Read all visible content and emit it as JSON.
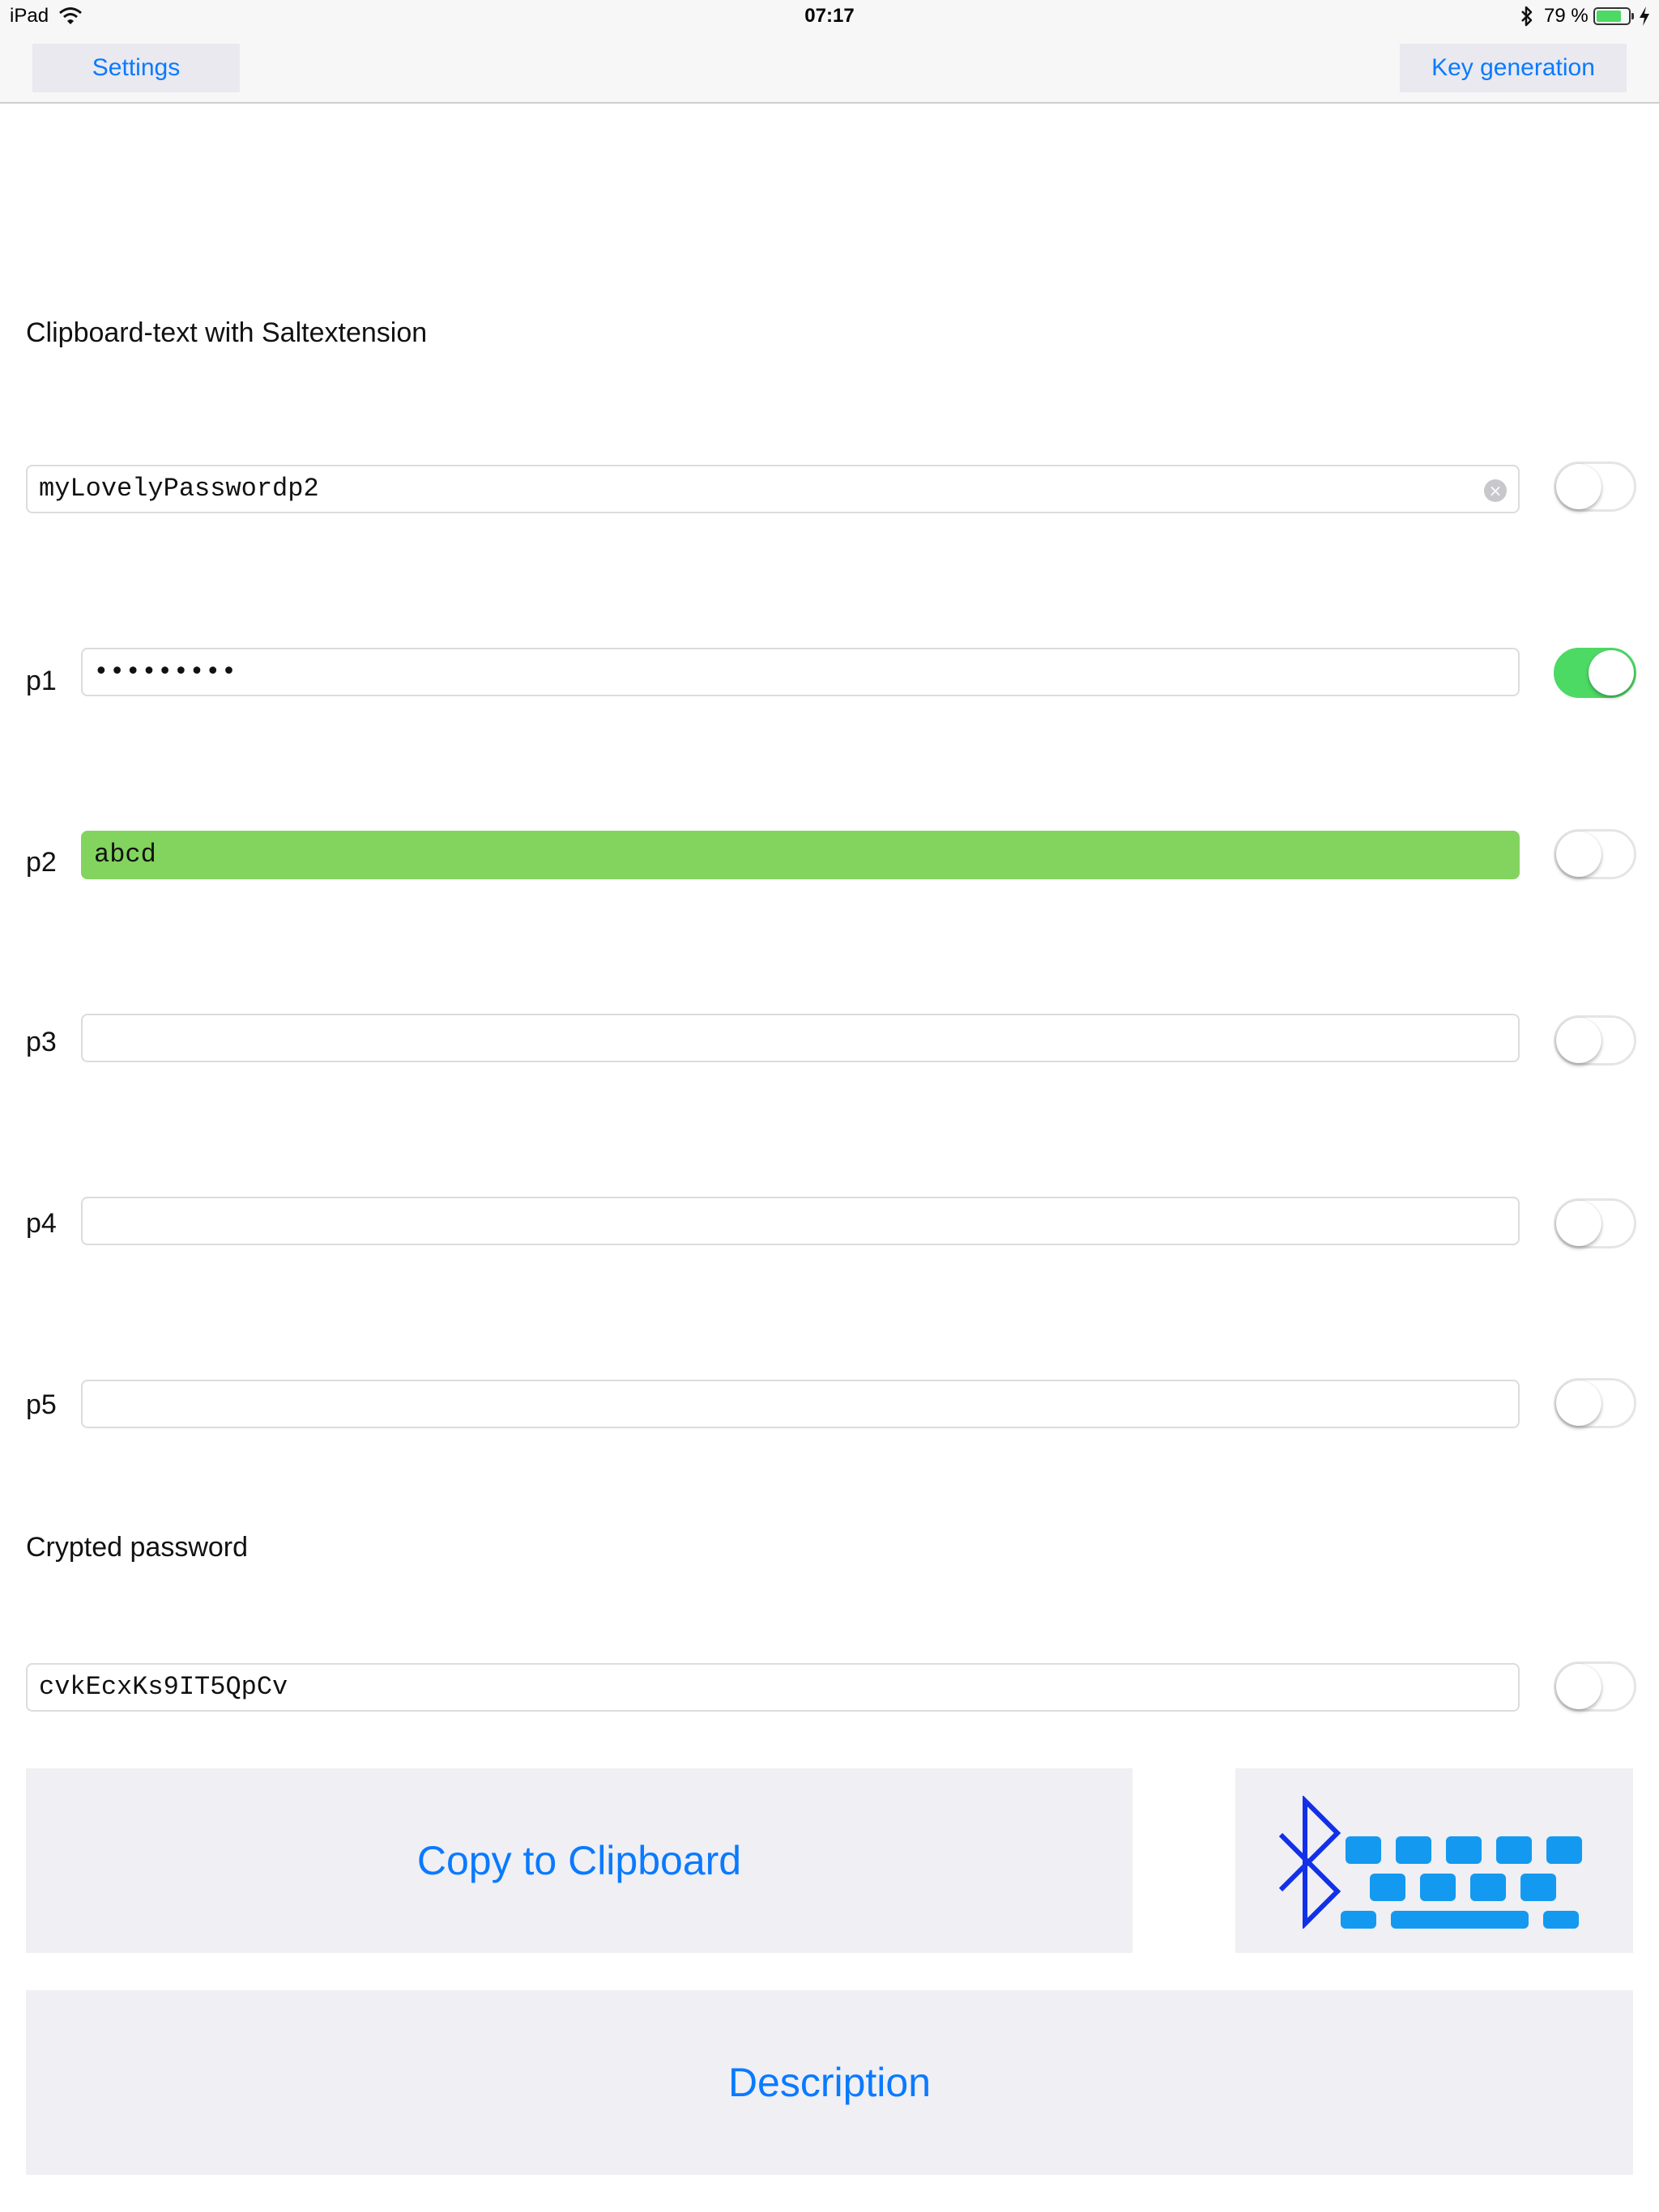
{
  "status_bar": {
    "device": "iPad",
    "time": "07:17",
    "battery_text": "79 %",
    "battery_level": 0.79,
    "icons": [
      "wifi-icon",
      "bluetooth-icon",
      "battery-icon",
      "charging-icon"
    ]
  },
  "nav": {
    "left_button": "Settings",
    "right_button": "Key generation"
  },
  "colors": {
    "accent": "#0a7aff",
    "toggle_on": "#4cd964",
    "highlight_field": "#82d45e",
    "bluetooth_blue": "#1230e8",
    "keyboard_blue": "#1499f0"
  },
  "salt_section": {
    "title": "Clipboard-text with Saltextension",
    "value": "myLovelyPasswordp2",
    "toggle_on": false
  },
  "params": [
    {
      "label": "p1",
      "value": "•••••••••",
      "toggle_on": true
    },
    {
      "label": "p2",
      "value": "abcd",
      "toggle_on": false
    },
    {
      "label": "p3",
      "value": "",
      "toggle_on": false
    },
    {
      "label": "p4",
      "value": "",
      "toggle_on": false
    },
    {
      "label": "p5",
      "value": "",
      "toggle_on": false
    }
  ],
  "crypted_section": {
    "title": "Crypted password",
    "value": "cvkEcxKs9IT5QpCv",
    "toggle_on": false
  },
  "buttons": {
    "copy": "Copy to Clipboard",
    "description": "Description",
    "bluetooth_keyboard_icon": "bluetooth-keyboard-icon"
  }
}
